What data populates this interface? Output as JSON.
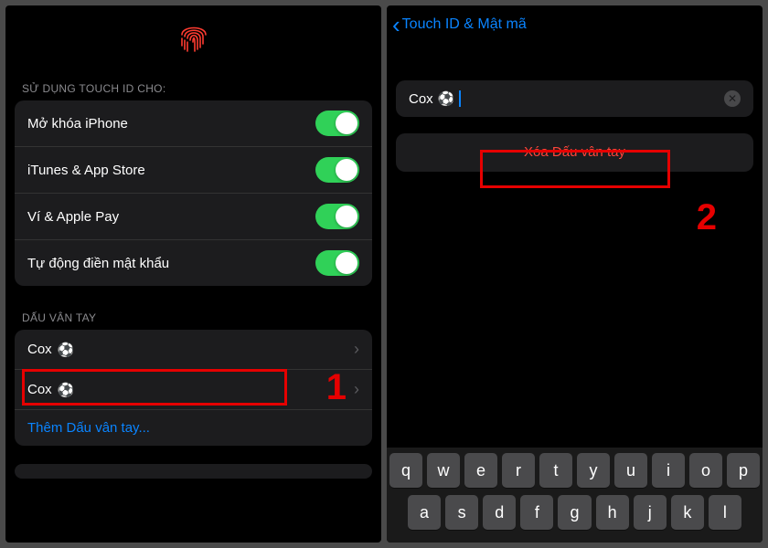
{
  "screen1": {
    "section_use_header": "SỬ DỤNG TOUCH ID CHO:",
    "toggles": [
      {
        "label": "Mở khóa iPhone"
      },
      {
        "label": "iTunes & App Store"
      },
      {
        "label": "Ví & Apple Pay"
      },
      {
        "label": "Tự động điền mật khẩu"
      }
    ],
    "section_fingerprints_header": "DẤU VÂN TAY",
    "fingerprints": [
      {
        "label": "Cox"
      },
      {
        "label": "Cox"
      }
    ],
    "add_fingerprint": "Thêm Dấu vân tay...",
    "step_number": "1"
  },
  "screen2": {
    "back_label": "Touch ID & Mật mã",
    "input_value": "Cox",
    "delete_label": "Xóa Dấu vân tay",
    "step_number": "2",
    "keyboard_rows": [
      [
        "q",
        "w",
        "e",
        "r",
        "t",
        "y",
        "u",
        "i",
        "o",
        "p"
      ],
      [
        "a",
        "s",
        "d",
        "f",
        "g",
        "h",
        "j",
        "k",
        "l"
      ]
    ]
  }
}
